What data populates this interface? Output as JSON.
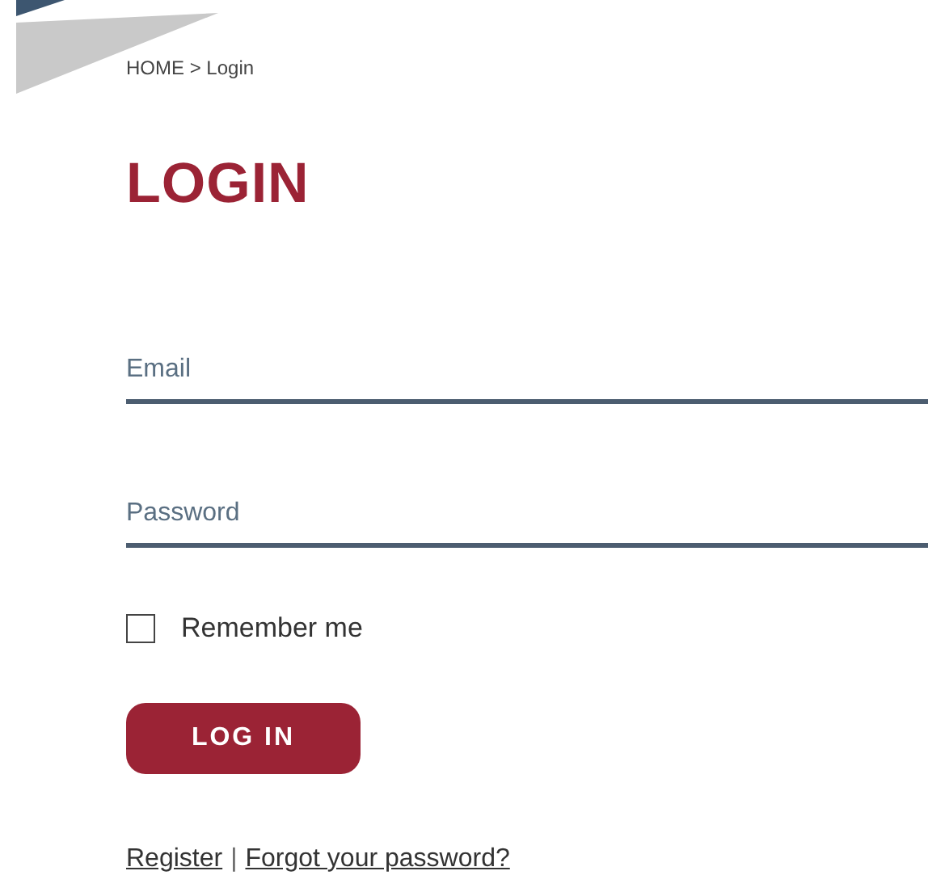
{
  "breadcrumb": "HOME > Login",
  "title": "LOGIN",
  "fields": [
    {
      "placeholder": "Email"
    },
    {
      "placeholder": "Password"
    }
  ],
  "remember": {
    "label": "Remember me",
    "checked": false
  },
  "submit": "LOG IN",
  "links": [
    {
      "label": "Register"
    },
    {
      "label": "Forgot your password?"
    }
  ],
  "link_separator": "|"
}
